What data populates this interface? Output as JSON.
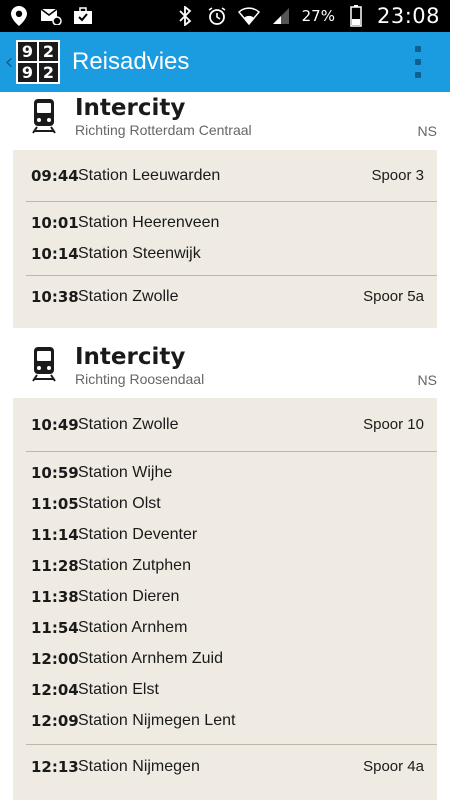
{
  "status_bar": {
    "battery_percent": "27%",
    "time": "23:08",
    "icons": [
      "location-icon",
      "email-icon",
      "briefcase-icon",
      "bluetooth-icon",
      "alarm-icon",
      "wifi-icon",
      "signal-icon",
      "battery-icon"
    ]
  },
  "appbar": {
    "title": "Reisadvies",
    "logo_digits": [
      "9",
      "2",
      "9",
      "2"
    ],
    "back_glyph": "‹",
    "accent_color": "#1b9be0"
  },
  "legs": [
    {
      "type": "Intercity",
      "direction": "Richting Rotterdam Centraal",
      "operator": "NS",
      "departure": {
        "time": "09:44",
        "station": "Station Leeuwarden",
        "platform": "Spoor 3"
      },
      "intermediate": [
        {
          "time": "10:01",
          "station": "Station Heerenveen"
        },
        {
          "time": "10:14",
          "station": "Station Steenwijk"
        }
      ],
      "arrival": {
        "time": "10:38",
        "station": "Station Zwolle",
        "platform": "Spoor 5a"
      }
    },
    {
      "type": "Intercity",
      "direction": "Richting Roosendaal",
      "operator": "NS",
      "departure": {
        "time": "10:49",
        "station": "Station Zwolle",
        "platform": "Spoor 10"
      },
      "intermediate": [
        {
          "time": "10:59",
          "station": "Station Wijhe"
        },
        {
          "time": "11:05",
          "station": "Station Olst"
        },
        {
          "time": "11:14",
          "station": "Station Deventer"
        },
        {
          "time": "11:28",
          "station": "Station Zutphen"
        },
        {
          "time": "11:38",
          "station": "Station Dieren"
        },
        {
          "time": "11:54",
          "station": "Station Arnhem"
        },
        {
          "time": "12:00",
          "station": "Station Arnhem Zuid"
        },
        {
          "time": "12:04",
          "station": "Station Elst"
        },
        {
          "time": "12:09",
          "station": "Station Nijmegen Lent"
        }
      ],
      "arrival": {
        "time": "12:13",
        "station": "Station Nijmegen",
        "platform": "Spoor 4a"
      }
    }
  ]
}
